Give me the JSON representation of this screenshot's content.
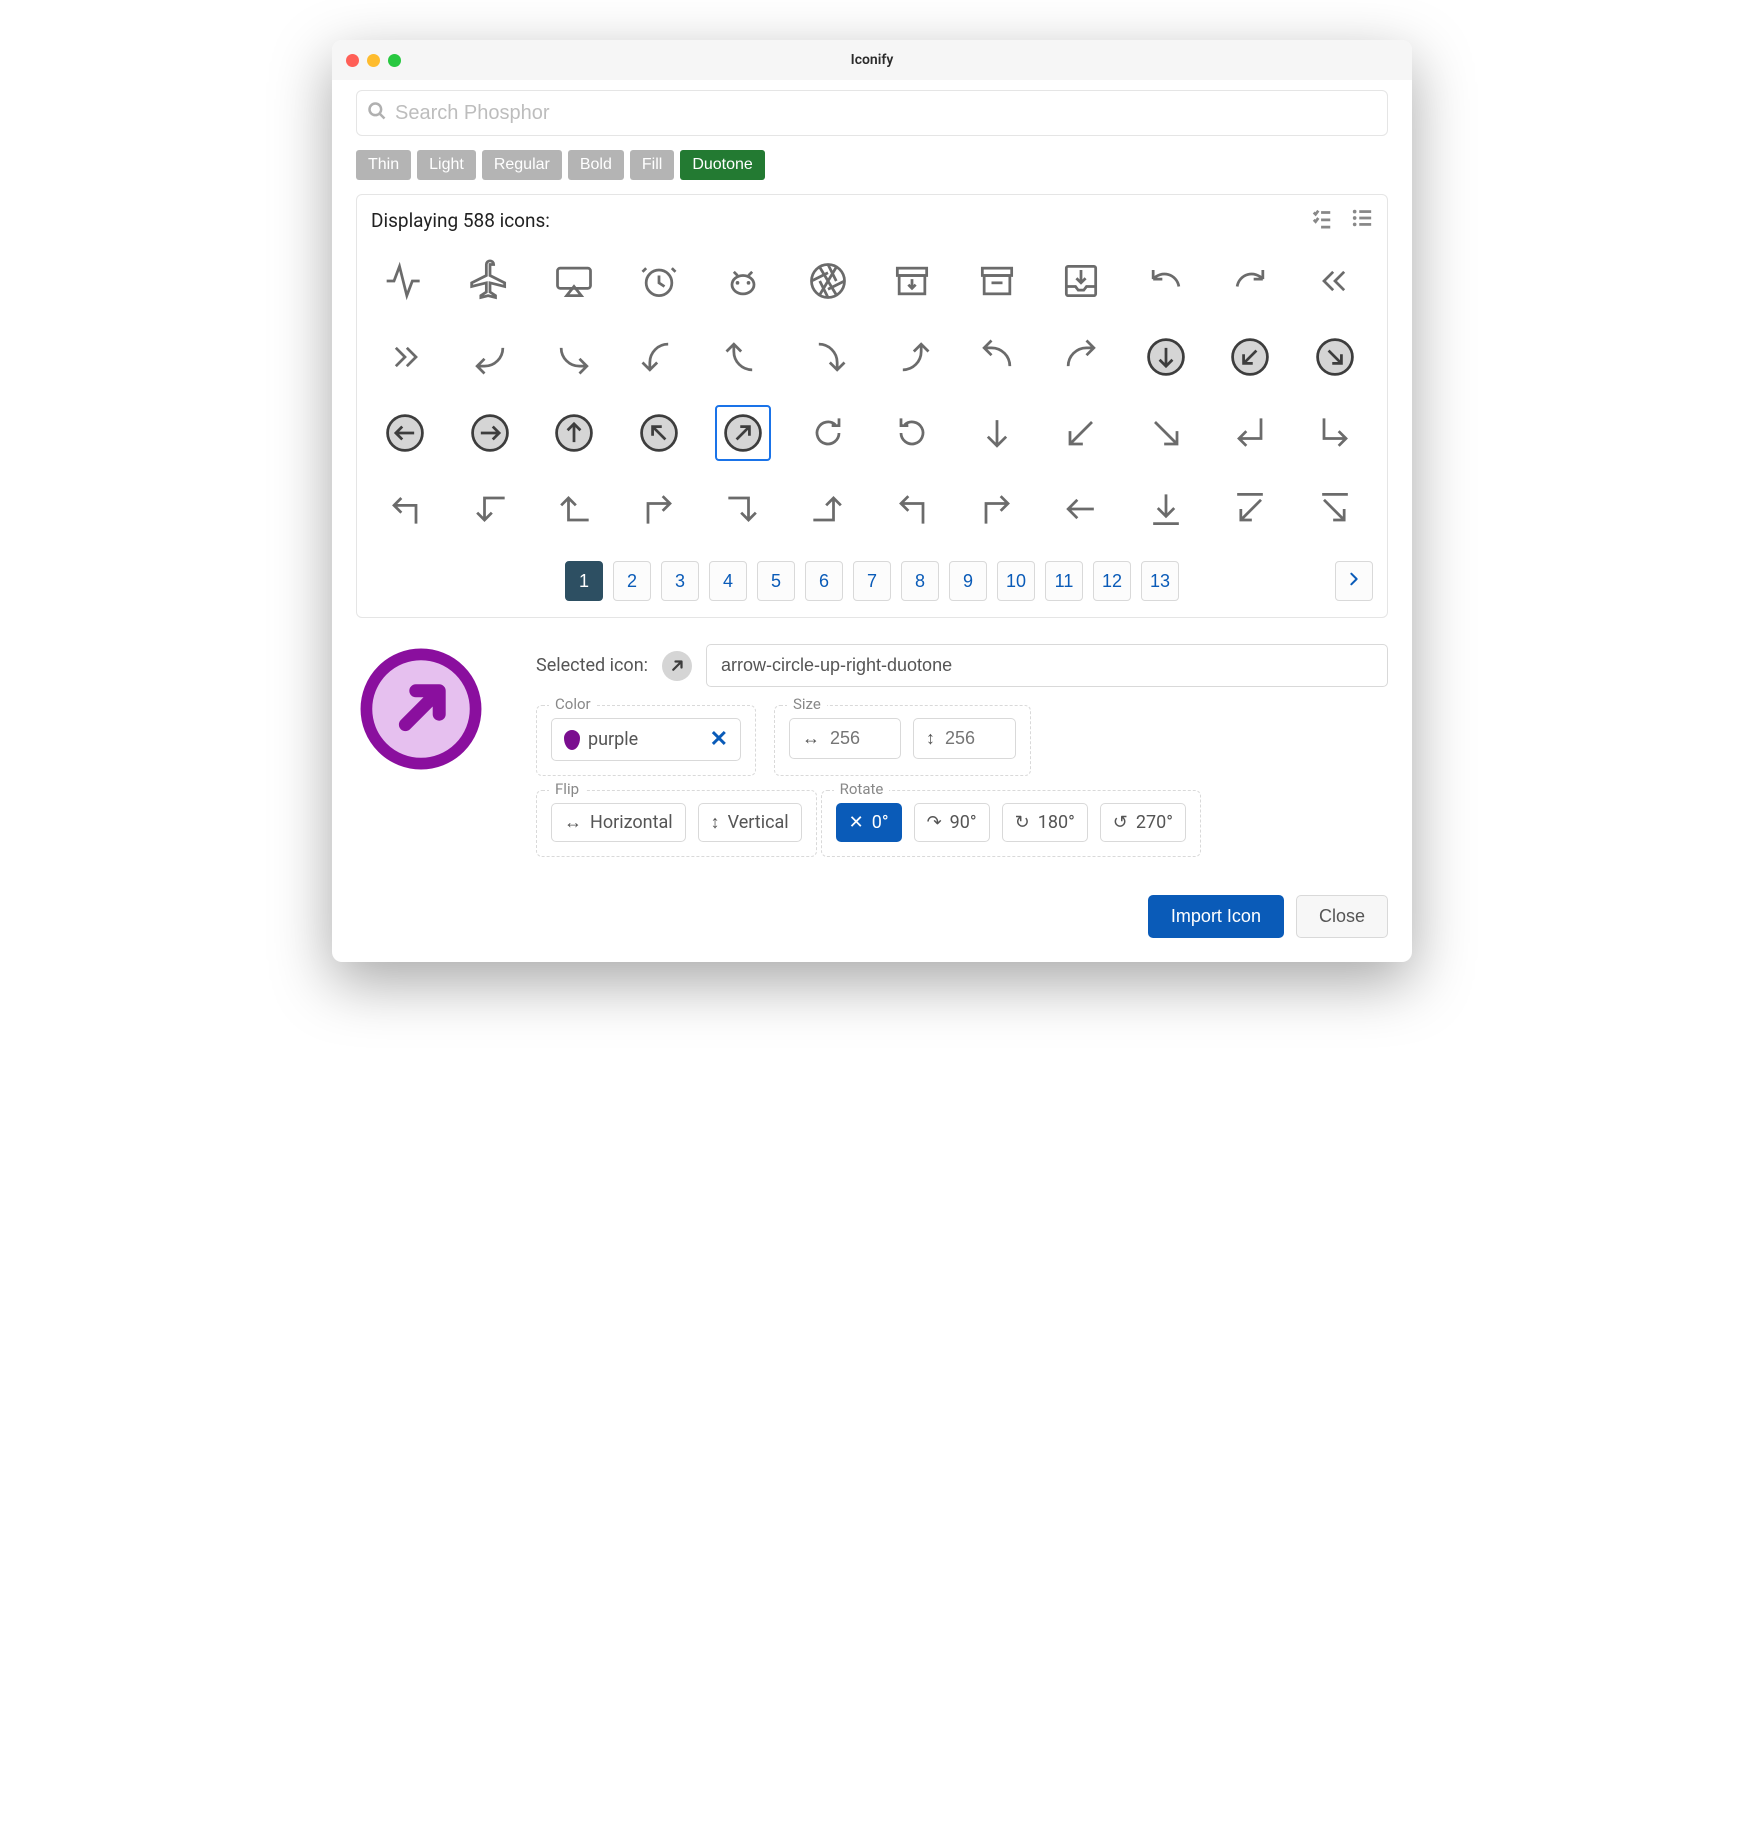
{
  "window": {
    "title": "Iconify"
  },
  "search": {
    "placeholder": "Search Phosphor"
  },
  "filters": [
    "Thin",
    "Light",
    "Regular",
    "Bold",
    "Fill",
    "Duotone"
  ],
  "active_filter": "Duotone",
  "panel": {
    "count_text": "Displaying 588 icons:"
  },
  "icons": [
    "activity",
    "airplane",
    "airplay",
    "alarm",
    "android-logo",
    "aperture",
    "archive-box",
    "archive",
    "archive-tray",
    "arrow-arc-left",
    "arrow-arc-right",
    "arrow-bend-double-up-left",
    "arrow-bend-double-up-right",
    "arrow-bend-down-left",
    "arrow-bend-down-right",
    "arrow-bend-left-down",
    "arrow-bend-left-up",
    "arrow-bend-right-down",
    "arrow-bend-right-up",
    "arrow-bend-up-left",
    "arrow-bend-up-right",
    "arrow-circle-down",
    "arrow-circle-down-left",
    "arrow-circle-down-right",
    "arrow-circle-left",
    "arrow-circle-right",
    "arrow-circle-up",
    "arrow-circle-up-left",
    "arrow-circle-up-right",
    "arrow-clockwise",
    "arrow-counter-clockwise",
    "arrow-down",
    "arrow-down-left",
    "arrow-down-right",
    "arrow-elbow-down-left",
    "arrow-elbow-down-right",
    "arrow-elbow-left",
    "arrow-elbow-left-down",
    "arrow-elbow-left-up",
    "arrow-elbow-right",
    "arrow-elbow-right-down",
    "arrow-elbow-right-up",
    "arrow-elbow-up-left",
    "arrow-elbow-up-right",
    "arrow-left",
    "arrow-line-down",
    "arrow-line-down-left",
    "arrow-line-down-right"
  ],
  "selected_index": 28,
  "pages": [
    "1",
    "2",
    "3",
    "4",
    "5",
    "6",
    "7",
    "8",
    "9",
    "10",
    "11",
    "12",
    "13"
  ],
  "active_page": "1",
  "selected": {
    "label": "Selected icon:",
    "value": "arrow-circle-up-right-duotone"
  },
  "color": {
    "label": "Color",
    "value": "purple"
  },
  "size": {
    "label": "Size",
    "width_placeholder": "256",
    "height_placeholder": "256"
  },
  "flip": {
    "label": "Flip",
    "horizontal": "Horizontal",
    "vertical": "Vertical"
  },
  "rotate": {
    "label": "Rotate",
    "options": [
      "0°",
      "90°",
      "180°",
      "270°"
    ],
    "active": "0°"
  },
  "footer": {
    "import": "Import Icon",
    "close": "Close"
  }
}
